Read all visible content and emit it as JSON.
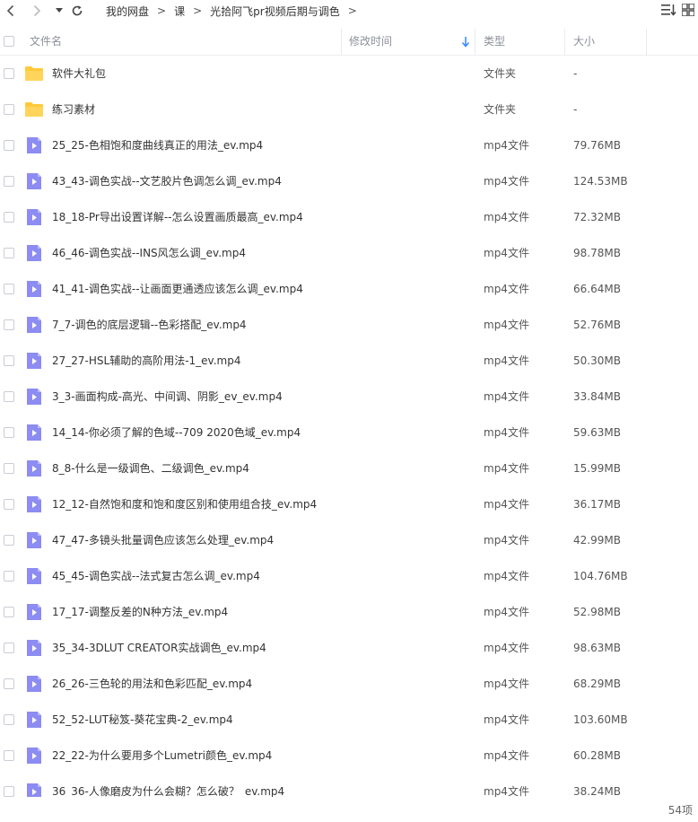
{
  "nav": {
    "back_icon": "chevron-left-icon",
    "forward_icon": "chevron-right-icon",
    "history_icon": "caret-down-icon",
    "refresh_icon": "refresh-icon",
    "breadcrumbs": [
      "我的网盘",
      "课",
      "光拾阿飞pr视频后期与调色"
    ],
    "separator": ">",
    "sort_menu_icon": "list-sort-icon"
  },
  "header": {
    "name_label": "文件名",
    "modified_label": "修改时间",
    "sort_icon": "sort-down-arrow-icon",
    "type_label": "类型",
    "size_label": "大小"
  },
  "colors": {
    "folder": "#ffcb3d",
    "video": "#8b8bf0",
    "sort_arrow": "#3b8cff"
  },
  "files": [
    {
      "name": "软件大礼包",
      "type": "文件夹",
      "size": "-",
      "kind": "folder"
    },
    {
      "name": "练习素材",
      "type": "文件夹",
      "size": "-",
      "kind": "folder"
    },
    {
      "name": "25_25-色相饱和度曲线真正的用法_ev.mp4",
      "type": "mp4文件",
      "size": "79.76MB",
      "kind": "video"
    },
    {
      "name": "43_43-调色实战--文艺胶片色调怎么调_ev.mp4",
      "type": "mp4文件",
      "size": "124.53MB",
      "kind": "video"
    },
    {
      "name": "18_18-Pr导出设置详解--怎么设置画质最高_ev.mp4",
      "type": "mp4文件",
      "size": "72.32MB",
      "kind": "video"
    },
    {
      "name": "46_46-调色实战--INS风怎么调_ev.mp4",
      "type": "mp4文件",
      "size": "98.78MB",
      "kind": "video"
    },
    {
      "name": "41_41-调色实战--让画面更通透应该怎么调_ev.mp4",
      "type": "mp4文件",
      "size": "66.64MB",
      "kind": "video"
    },
    {
      "name": "7_7-调色的底层逻辑--色彩搭配_ev.mp4",
      "type": "mp4文件",
      "size": "52.76MB",
      "kind": "video"
    },
    {
      "name": "27_27-HSL辅助的高阶用法-1_ev.mp4",
      "type": "mp4文件",
      "size": "50.30MB",
      "kind": "video"
    },
    {
      "name": "3_3-画面构成-高光、中间调、阴影_ev_ev.mp4",
      "type": "mp4文件",
      "size": "33.84MB",
      "kind": "video"
    },
    {
      "name": "14_14-你必须了解的色域--709 2020色域_ev.mp4",
      "type": "mp4文件",
      "size": "59.63MB",
      "kind": "video"
    },
    {
      "name": "8_8-什么是一级调色、二级调色_ev.mp4",
      "type": "mp4文件",
      "size": "15.99MB",
      "kind": "video"
    },
    {
      "name": "12_12-自然饱和度和饱和度区别和使用组合技_ev.mp4",
      "type": "mp4文件",
      "size": "36.17MB",
      "kind": "video"
    },
    {
      "name": "47_47-多镜头批量调色应该怎么处理_ev.mp4",
      "type": "mp4文件",
      "size": "42.99MB",
      "kind": "video"
    },
    {
      "name": "45_45-调色实战--法式复古怎么调_ev.mp4",
      "type": "mp4文件",
      "size": "104.76MB",
      "kind": "video"
    },
    {
      "name": "17_17-调整反差的N种方法_ev.mp4",
      "type": "mp4文件",
      "size": "52.98MB",
      "kind": "video"
    },
    {
      "name": "35_34-3DLUT CREATOR实战调色_ev.mp4",
      "type": "mp4文件",
      "size": "98.63MB",
      "kind": "video"
    },
    {
      "name": "26_26-三色轮的用法和色彩匹配_ev.mp4",
      "type": "mp4文件",
      "size": "68.29MB",
      "kind": "video"
    },
    {
      "name": "52_52-LUT秘笈-葵花宝典-2_ev.mp4",
      "type": "mp4文件",
      "size": "103.60MB",
      "kind": "video"
    },
    {
      "name": "22_22-为什么要用多个Lumetri颜色_ev.mp4",
      "type": "mp4文件",
      "size": "60.28MB",
      "kind": "video"
    },
    {
      "name": "36_36-人像磨皮为什么会糊？怎么破？_ev.mp4",
      "type": "mp4文件",
      "size": "38.24MB",
      "kind": "video"
    }
  ],
  "footer": {
    "count": "54项"
  }
}
